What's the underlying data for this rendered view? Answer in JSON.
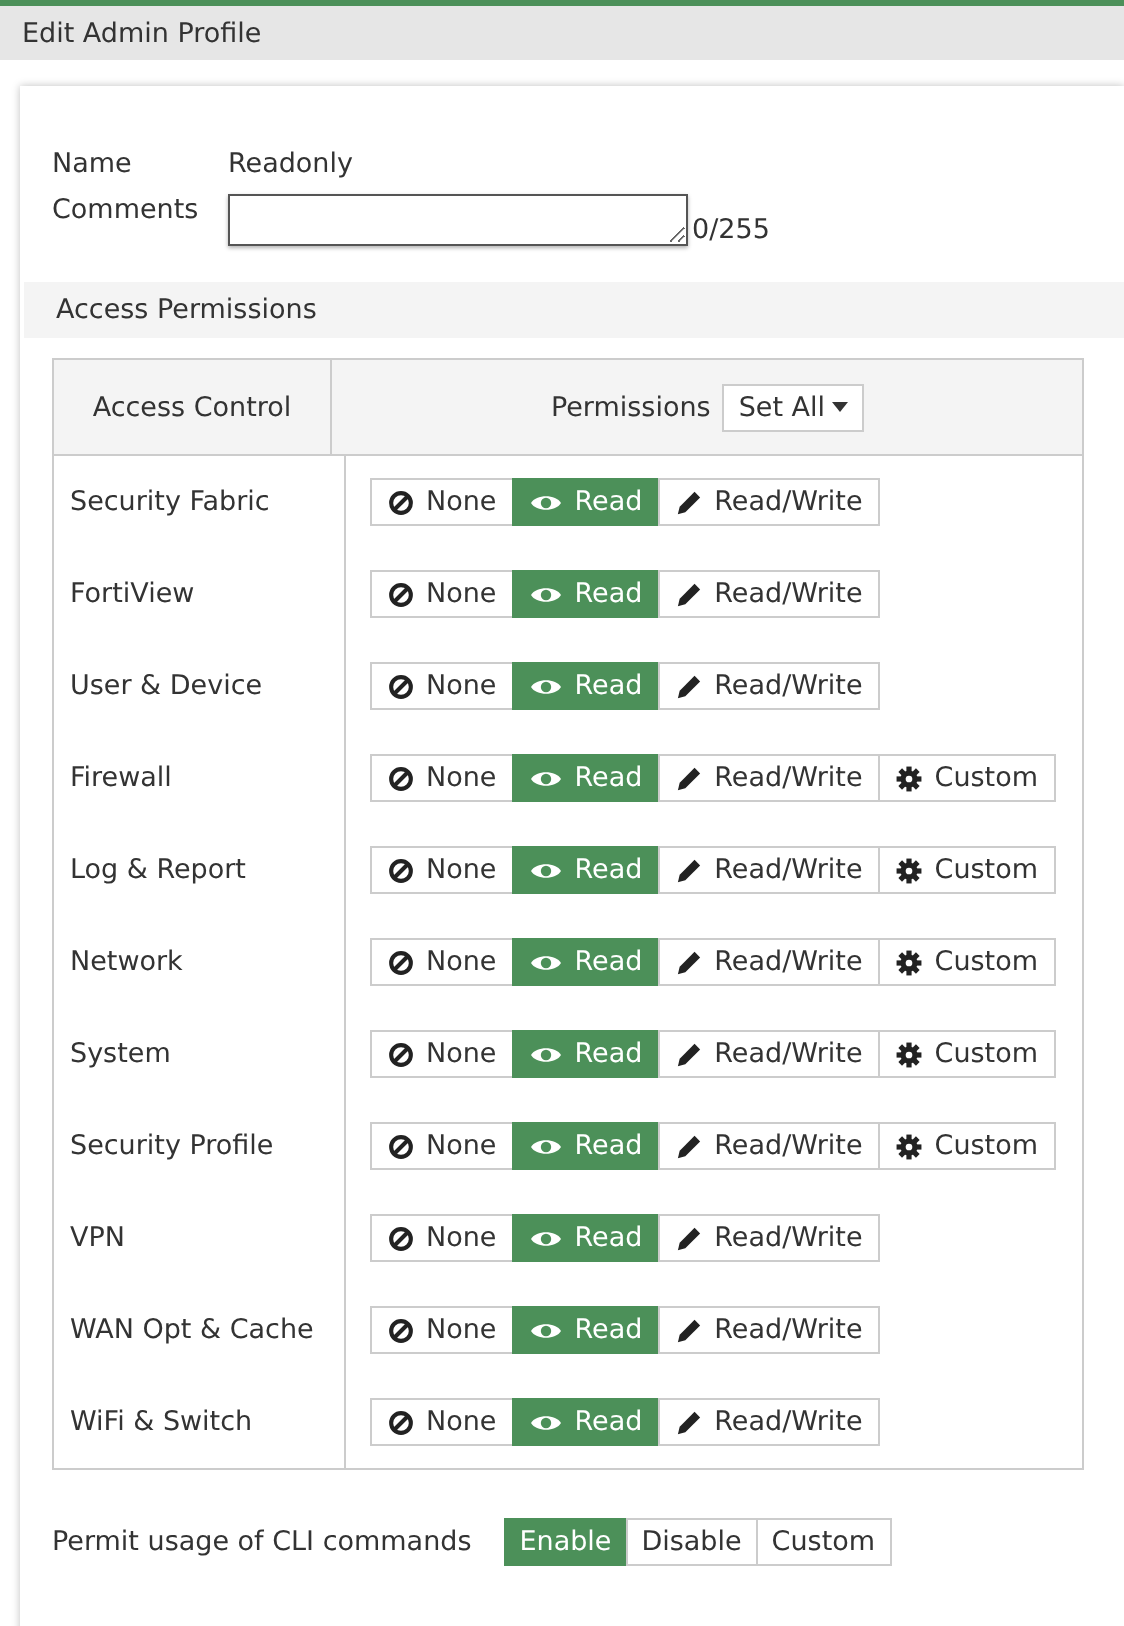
{
  "window": {
    "title": "Edit Admin Profile"
  },
  "form": {
    "name_label": "Name",
    "name_value": "Readonly",
    "comments_label": "Comments",
    "comments_counter": "0/255"
  },
  "section": {
    "title": "Access Permissions"
  },
  "table": {
    "columns": [
      "Access Control",
      "Permissions"
    ],
    "set_all": "Set All",
    "rows": [
      {
        "label": "Security Fabric",
        "options": [
          {
            "kind": "none",
            "label": "None",
            "selected": false
          },
          {
            "kind": "read",
            "label": "Read",
            "selected": true
          },
          {
            "kind": "readwrite",
            "label": "Read/Write",
            "selected": false
          }
        ]
      },
      {
        "label": "FortiView",
        "options": [
          {
            "kind": "none",
            "label": "None",
            "selected": false
          },
          {
            "kind": "read",
            "label": "Read",
            "selected": true
          },
          {
            "kind": "readwrite",
            "label": "Read/Write",
            "selected": false
          }
        ]
      },
      {
        "label": "User & Device",
        "options": [
          {
            "kind": "none",
            "label": "None",
            "selected": false
          },
          {
            "kind": "read",
            "label": "Read",
            "selected": true
          },
          {
            "kind": "readwrite",
            "label": "Read/Write",
            "selected": false
          }
        ]
      },
      {
        "label": "Firewall",
        "options": [
          {
            "kind": "none",
            "label": "None",
            "selected": false
          },
          {
            "kind": "read",
            "label": "Read",
            "selected": true
          },
          {
            "kind": "readwrite",
            "label": "Read/Write",
            "selected": false
          },
          {
            "kind": "custom",
            "label": "Custom",
            "selected": false
          }
        ]
      },
      {
        "label": "Log & Report",
        "options": [
          {
            "kind": "none",
            "label": "None",
            "selected": false
          },
          {
            "kind": "read",
            "label": "Read",
            "selected": true
          },
          {
            "kind": "readwrite",
            "label": "Read/Write",
            "selected": false
          },
          {
            "kind": "custom",
            "label": "Custom",
            "selected": false
          }
        ]
      },
      {
        "label": "Network",
        "options": [
          {
            "kind": "none",
            "label": "None",
            "selected": false
          },
          {
            "kind": "read",
            "label": "Read",
            "selected": true
          },
          {
            "kind": "readwrite",
            "label": "Read/Write",
            "selected": false
          },
          {
            "kind": "custom",
            "label": "Custom",
            "selected": false
          }
        ]
      },
      {
        "label": "System",
        "options": [
          {
            "kind": "none",
            "label": "None",
            "selected": false
          },
          {
            "kind": "read",
            "label": "Read",
            "selected": true
          },
          {
            "kind": "readwrite",
            "label": "Read/Write",
            "selected": false
          },
          {
            "kind": "custom",
            "label": "Custom",
            "selected": false
          }
        ]
      },
      {
        "label": "Security Profile",
        "options": [
          {
            "kind": "none",
            "label": "None",
            "selected": false
          },
          {
            "kind": "read",
            "label": "Read",
            "selected": true
          },
          {
            "kind": "readwrite",
            "label": "Read/Write",
            "selected": false
          },
          {
            "kind": "custom",
            "label": "Custom",
            "selected": false
          }
        ]
      },
      {
        "label": "VPN",
        "options": [
          {
            "kind": "none",
            "label": "None",
            "selected": false
          },
          {
            "kind": "read",
            "label": "Read",
            "selected": true
          },
          {
            "kind": "readwrite",
            "label": "Read/Write",
            "selected": false
          }
        ]
      },
      {
        "label": "WAN Opt & Cache",
        "options": [
          {
            "kind": "none",
            "label": "None",
            "selected": false
          },
          {
            "kind": "read",
            "label": "Read",
            "selected": true
          },
          {
            "kind": "readwrite",
            "label": "Read/Write",
            "selected": false
          }
        ]
      },
      {
        "label": "WiFi & Switch",
        "options": [
          {
            "kind": "none",
            "label": "None",
            "selected": false
          },
          {
            "kind": "read",
            "label": "Read",
            "selected": true
          },
          {
            "kind": "readwrite",
            "label": "Read/Write",
            "selected": false
          }
        ]
      }
    ]
  },
  "cli": {
    "label": "Permit usage of CLI commands",
    "options": [
      {
        "label": "Enable",
        "selected": true
      },
      {
        "label": "Disable",
        "selected": false
      },
      {
        "label": "Custom",
        "selected": false
      }
    ]
  }
}
